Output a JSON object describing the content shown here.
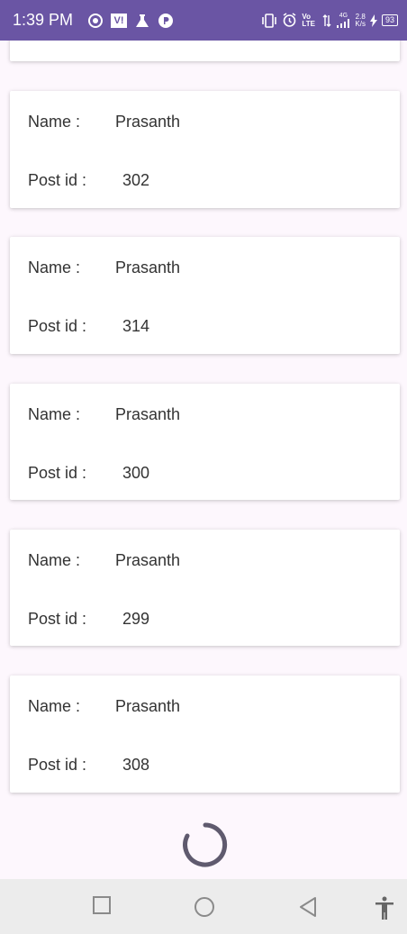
{
  "status_bar": {
    "time": "1:39 PM",
    "vi_label": "V!",
    "volte": "Vo LTE",
    "network": "4G",
    "speed_value": "2.8",
    "speed_unit": "K/s",
    "battery": "93"
  },
  "posts": [
    {
      "name_label": "Name :",
      "name": "Prasanth",
      "post_label": "Post id :",
      "post_id": "302"
    },
    {
      "name_label": "Name :",
      "name": "Prasanth",
      "post_label": "Post id :",
      "post_id": "314"
    },
    {
      "name_label": "Name :",
      "name": "Prasanth",
      "post_label": "Post id :",
      "post_id": "300"
    },
    {
      "name_label": "Name :",
      "name": "Prasanth",
      "post_label": "Post id :",
      "post_id": "299"
    },
    {
      "name_label": "Name :",
      "name": "Prasanth",
      "post_label": "Post id :",
      "post_id": "308"
    }
  ],
  "colors": {
    "status_bar": "#6a55a4",
    "background": "#fdf7fd",
    "spinner": "#5f5a6e",
    "nav_bar": "#ececec"
  },
  "icons": [
    "location-icon",
    "flask-icon",
    "p-app-icon",
    "vibrate-icon",
    "alarm-icon",
    "signal-icon",
    "charging-icon",
    "recents-icon",
    "home-icon",
    "back-icon",
    "accessibility-icon"
  ]
}
